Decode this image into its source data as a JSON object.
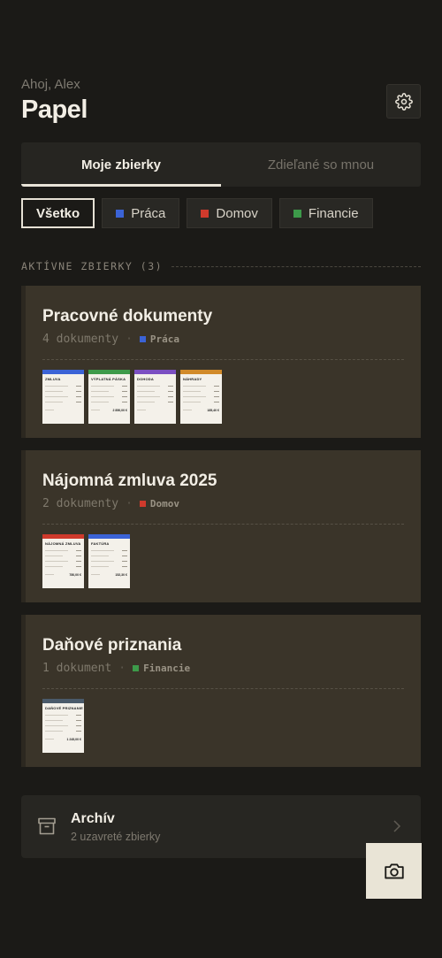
{
  "header": {
    "greeting": "Ahoj, Alex",
    "title": "Papel",
    "settings_icon": "gear-icon"
  },
  "tabs": [
    {
      "label": "Moje zbierky",
      "active": true
    },
    {
      "label": "Zdieľané so mnou",
      "active": false
    }
  ],
  "filters": [
    {
      "label": "Všetko",
      "active": true,
      "color": ""
    },
    {
      "label": "Práca",
      "active": false,
      "color": "#3b63d6"
    },
    {
      "label": "Domov",
      "active": false,
      "color": "#cf3a2c"
    },
    {
      "label": "Financie",
      "active": false,
      "color": "#3d9a4a"
    }
  ],
  "section": {
    "label": "AKTÍVNE ZBIERKY (3)"
  },
  "collections": [
    {
      "title": "Pracovné dokumenty",
      "meta": "4 dokumenty",
      "tag": "Práca",
      "tag_color": "#3b63d6",
      "docs": [
        {
          "title": "ZMLUVA",
          "color": "#3b63d6",
          "amount": ""
        },
        {
          "title": "VÝPLATNÁ PÁSKA",
          "color": "#3d9a4a",
          "amount": "2 850,00 €"
        },
        {
          "title": "DOHODA",
          "color": "#7b4fc2",
          "amount": ""
        },
        {
          "title": "NÁHRADY",
          "color": "#d18a2a",
          "amount": "185,40 €"
        }
      ]
    },
    {
      "title": "Nájomná zmluva 2025",
      "meta": "2 dokumenty",
      "tag": "Domov",
      "tag_color": "#cf3a2c",
      "docs": [
        {
          "title": "NÁJOMNÁ ZMLUVA",
          "color": "#cf3a2c",
          "amount": "780,00 €"
        },
        {
          "title": "FAKTÚRA",
          "color": "#3b63d6",
          "amount": "152,30 €"
        }
      ]
    },
    {
      "title": "Daňové priznania",
      "meta": "1 dokument",
      "tag": "Financie",
      "tag_color": "#3d9a4a",
      "docs": [
        {
          "title": "DAŇOVÉ PRIZNANIE",
          "color": "#4a5a6a",
          "amount": "1 245,00 €"
        }
      ]
    }
  ],
  "archive": {
    "title": "Archív",
    "subtitle": "2 uzavreté zbierky",
    "icon": "archive-box-icon"
  },
  "fab": {
    "icon": "camera-icon"
  }
}
